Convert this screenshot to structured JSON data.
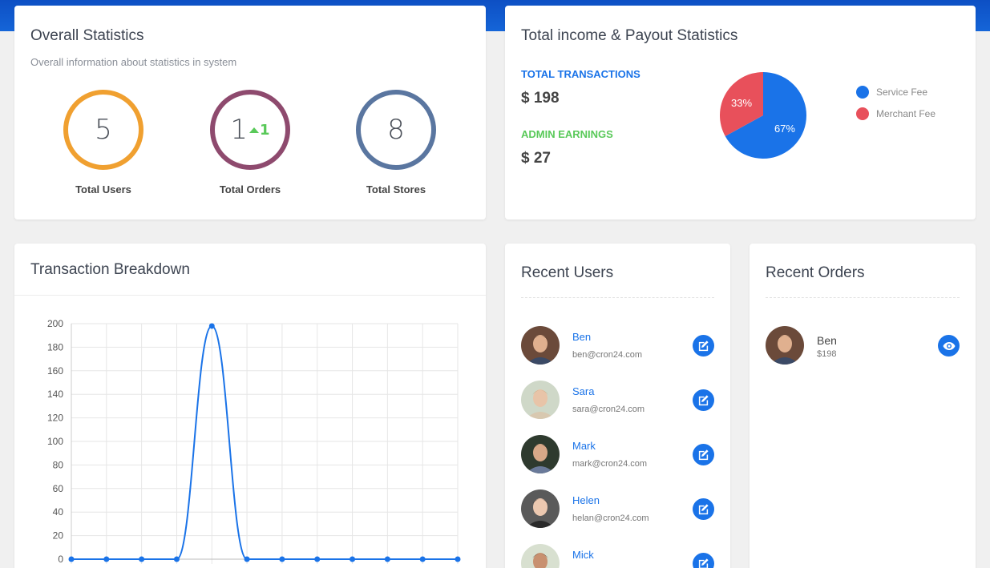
{
  "overall": {
    "title": "Overall Statistics",
    "subtitle": "Overall information about statistics in system",
    "stats": [
      {
        "value": "5",
        "label": "Total Users",
        "color": "#f0a030"
      },
      {
        "value": "1",
        "delta": "1",
        "label": "Total Orders",
        "color": "#8e4a6e"
      },
      {
        "value": "8",
        "label": "Total Stores",
        "color": "#5a76a0"
      }
    ]
  },
  "income": {
    "title": "Total income & Payout Statistics",
    "transactions_label": "TOTAL TRANSACTIONS",
    "transactions_value": "$ 198",
    "earnings_label": "ADMIN EARNINGS",
    "earnings_value": "$ 27",
    "pie": [
      {
        "name": "Service Fee",
        "value": 67,
        "label": "67%",
        "color": "#1a73e8"
      },
      {
        "name": "Merchant Fee",
        "value": 33,
        "label": "33%",
        "color": "#e8505b"
      }
    ],
    "colors": {
      "transactions": "#1a73e8",
      "earnings": "#59c959"
    }
  },
  "transaction": {
    "title": "Transaction Breakdown"
  },
  "chart_data": {
    "type": "line",
    "title": "",
    "xlabel": "",
    "ylabel": "",
    "ylim": [
      0,
      200
    ],
    "yticks": [
      0,
      20,
      40,
      60,
      80,
      100,
      120,
      140,
      160,
      180,
      200
    ],
    "series": [
      {
        "values": [
          0,
          0,
          0,
          0,
          198,
          0,
          0,
          0,
          0,
          0,
          0,
          0
        ],
        "color": "#1a73e8"
      }
    ],
    "grid": true
  },
  "users": {
    "title": "Recent Users",
    "items": [
      {
        "name": "Ben",
        "email": "ben@cron24.com",
        "icon": "edit-icon"
      },
      {
        "name": "Sara",
        "email": "sara@cron24.com",
        "icon": "edit-icon"
      },
      {
        "name": "Mark",
        "email": "mark@cron24.com",
        "icon": "edit-icon"
      },
      {
        "name": "Helen",
        "email": "helan@cron24.com",
        "icon": "edit-icon"
      },
      {
        "name": "Mick",
        "email": "",
        "icon": "edit-icon"
      }
    ]
  },
  "orders": {
    "title": "Recent Orders",
    "items": [
      {
        "name": "Ben",
        "price": "$198",
        "icon": "eye-icon"
      }
    ]
  }
}
